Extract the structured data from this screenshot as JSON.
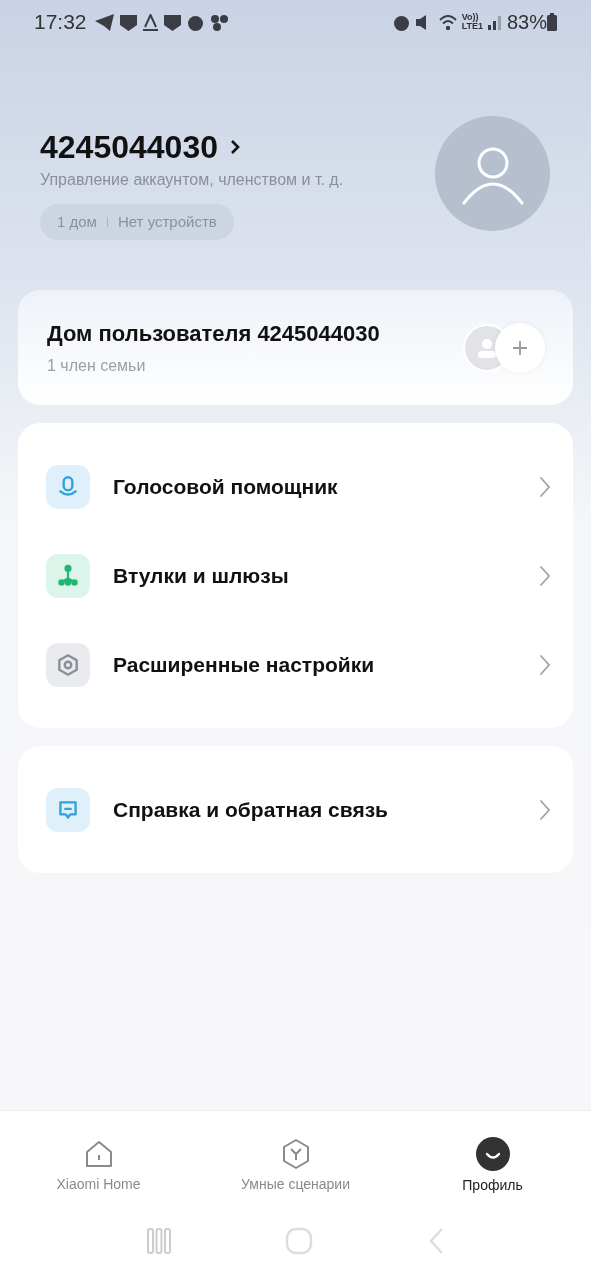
{
  "status_bar": {
    "time": "17:32",
    "volte": "Vo))",
    "network": "LTE1",
    "battery": "83%"
  },
  "profile": {
    "account_id": "4245044030",
    "subtitle": "Управление аккаунтом, членством и т. д.",
    "stats": [
      "1 дом",
      "Нет устройств"
    ]
  },
  "home_card": {
    "title": "Дом пользователя 4245044030",
    "members": "1 член семьи"
  },
  "menu_groups": [
    [
      {
        "kind": "voice",
        "label": "Голосовой помощник"
      },
      {
        "kind": "hub",
        "label": "Втулки и шлюзы"
      },
      {
        "kind": "settings",
        "label": "Расширенные настройки"
      }
    ],
    [
      {
        "kind": "help",
        "label": "Справка и обратная связь"
      }
    ]
  ],
  "tabs": [
    {
      "kind": "home",
      "label": "Xiaomi Home",
      "selected": false
    },
    {
      "kind": "scenes",
      "label": "Умные сценарии",
      "selected": false
    },
    {
      "kind": "profile",
      "label": "Профиль",
      "selected": true
    }
  ]
}
